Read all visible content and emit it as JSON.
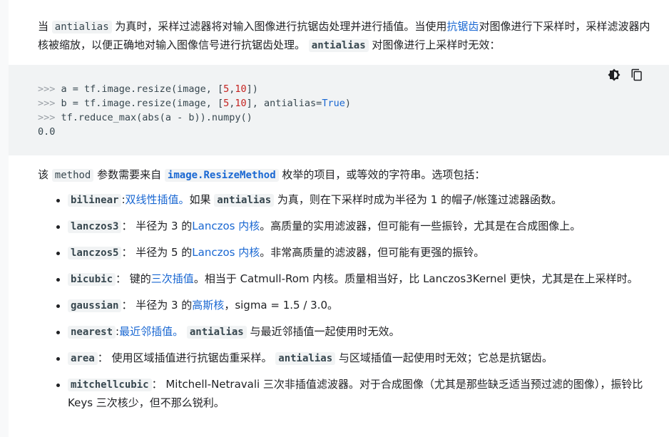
{
  "para1": {
    "t1": "当 ",
    "c1": "antialias",
    "t2": " 为真时，采样过滤器将对输入图像进行抗锯齿处理并进行插值。当使用",
    "link1": "抗锯齿",
    "t3": "对图像进行下采样时，采样滤波器内核被缩放，以便正确地对输入图像信号进行抗锯齿处理。 ",
    "c2": "antialias",
    "t4": " 对图像进行上采样时无效："
  },
  "code_block": {
    "line1": [
      ">>> ",
      "a = tf.image.resize(image, [",
      "5",
      ",",
      "10",
      "])"
    ],
    "line2": [
      ">>> ",
      "b = tf.image.resize(image, [",
      "5",
      ",",
      "10",
      "], antialias=",
      "True",
      ")"
    ],
    "line3": [
      ">>> ",
      "tf.reduce_max(abs(a - b)).numpy()"
    ],
    "line4": "0.0",
    "icons": [
      "theme-toggle-icon",
      "copy-icon"
    ]
  },
  "para2": {
    "t1": "该 ",
    "c1": "method",
    "t2": " 参数需要来自 ",
    "c2": "image.ResizeMethod",
    "t3": " 枚举的项目，或等效的字符串。选项包括："
  },
  "options": [
    {
      "code": "bilinear",
      "parts": [
        ":",
        "双线性插值。",
        "如果 ",
        "antialias",
        " 为真，则在下采样时成为半径为 1 的帽子/帐篷过滤器函数。"
      ]
    },
    {
      "code": "lanczos3",
      "parts": [
        "：  半径为 3 的",
        "Lanczos 内核",
        "。高质量的实用滤波器，但可能有一些振铃，尤其是在合成图像上。"
      ]
    },
    {
      "code": "lanczos5",
      "parts": [
        "：  半径为 5 的",
        "Lanczos 内核",
        "。非常高质量的滤波器，但可能有更强的振铃。"
      ]
    },
    {
      "code": "bicubic",
      "parts": [
        "：  键的",
        "三次插值",
        "。相当于 Catmull-Rom 内核。质量相当好，比 Lanczos3Kernel 更快，尤其是在上采样时。"
      ]
    },
    {
      "code": "gaussian",
      "parts": [
        "：  半径为 3 的",
        "高斯核",
        "，sigma = 1.5 / 3.0。"
      ]
    },
    {
      "code": "nearest",
      "parts": [
        ":",
        "最近邻插值。",
        " ",
        "antialias",
        " 与最近邻插值一起使用时无效。"
      ]
    },
    {
      "code": "area",
      "parts": [
        "：  使用区域插值进行抗锯齿重采样。 ",
        "antialias",
        " 与区域插值一起使用时无效；它总是抗锯齿。"
      ]
    },
    {
      "code": "mitchellcubic",
      "parts": [
        "：  Mitchell-Netravali 三次非插值滤波器。对于合成图像（尤其是那些缺乏适当预过滤的图像），振铃比 Keys 三次核少，但不那么锐利。"
      ]
    }
  ]
}
